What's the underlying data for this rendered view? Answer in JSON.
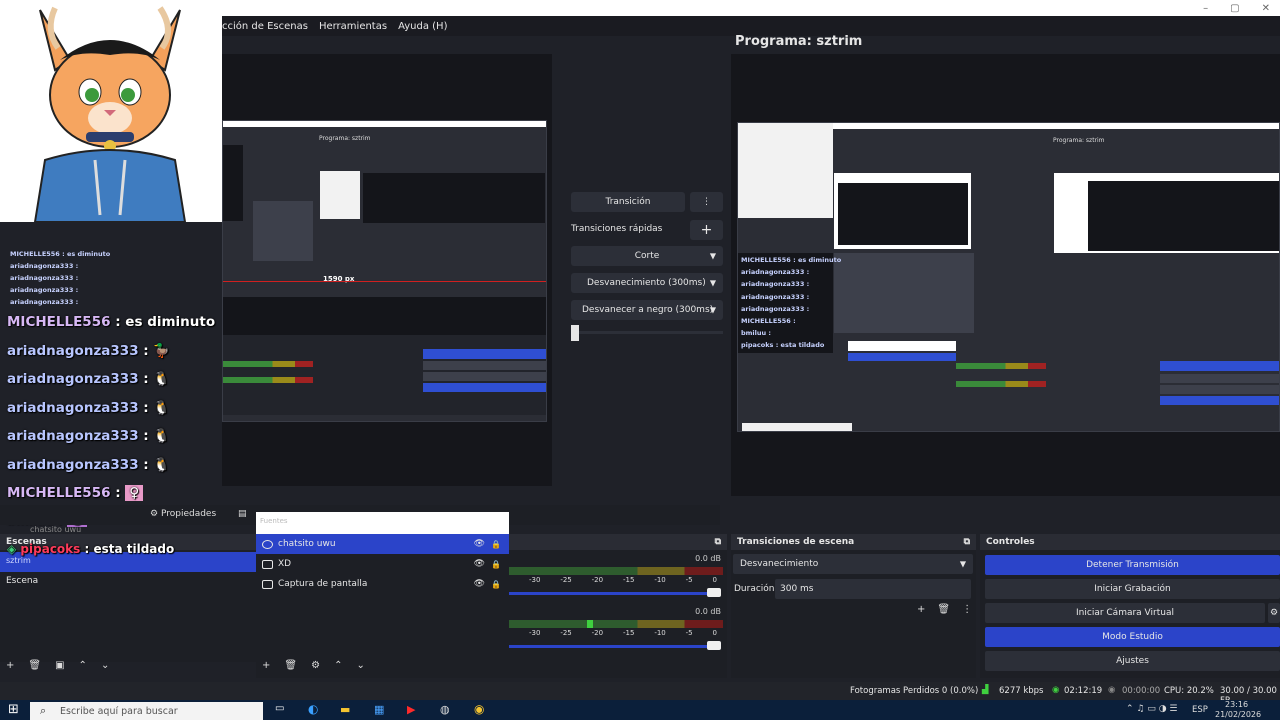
{
  "window": {
    "controls": [
      "–",
      "▢",
      "✕"
    ]
  },
  "menu": {
    "items": [
      "cción de Escenas",
      "Herramientas",
      "Ayuda (H)"
    ]
  },
  "program": {
    "title": "Programa: sztrim"
  },
  "nested_preview": {
    "left_title": "Programa: sztrim",
    "right_title": "Programa: sztrim",
    "px_label": "1590 px",
    "nested_chat": [
      "MICHELLE556 : es diminuto",
      "ariadnagonza333 :",
      "ariadnagonza333 :",
      "ariadnagonza333 :",
      "ariadnagonza333 :",
      "MICHELLE556 :"
    ],
    "nested_chat_right": [
      "MICHELLE556 : es diminuto",
      "ariadnagonza333 :",
      "ariadnagonza333 :",
      "ariadnagonza333 :",
      "ariadnagonza333 :",
      "MICHELLE556 :",
      "bmiluu :",
      "pipacoks : esta tildado"
    ]
  },
  "transition_panel": {
    "transition_button": "Transición",
    "quick_transitions_label": "Transiciones rápidas",
    "options": [
      "Corte",
      "Desvanecimiento (300ms)",
      "Desvanecer a negro (300ms)"
    ]
  },
  "chat": [
    {
      "user": "MICHELLE556",
      "text": ": es diminuto",
      "kind": "mich"
    },
    {
      "user": "ariadnagonza333",
      "text": ":",
      "kind": "aria"
    },
    {
      "user": "ariadnagonza333",
      "text": ":",
      "kind": "aria"
    },
    {
      "user": "ariadnagonza333",
      "text": ":",
      "kind": "aria"
    },
    {
      "user": "ariadnagonza333",
      "text": ":",
      "kind": "aria"
    },
    {
      "user": "MICHELLE556",
      "text": ":",
      "kind": "mich"
    },
    {
      "user": "bmiluu",
      "text": ":",
      "kind": "bmil"
    },
    {
      "user": "pipacoks",
      "text": ": esta tildado",
      "kind": "pipa"
    }
  ],
  "dock_tabs": {
    "properties": "Propiedades",
    "chat_label": "chatsito uwu",
    "fuentes_label": "Fuentes"
  },
  "scenes": {
    "header": "Escenas",
    "selected": "sztrim",
    "items": [
      "Escena"
    ]
  },
  "sources": {
    "items": [
      {
        "name": "chatsito uwu",
        "selected": true
      },
      {
        "name": "XD",
        "selected": false
      },
      {
        "name": "Captura de pantalla",
        "selected": false
      }
    ]
  },
  "audio": {
    "db1": "0.0 dB",
    "db2": "0.0 dB",
    "scale": [
      "-30",
      "-25",
      "-20",
      "-15",
      "-10",
      "-5",
      "0"
    ]
  },
  "scene_transitions": {
    "header": "Transiciones de escena",
    "selected": "Desvanecimiento",
    "duration_label": "Duración",
    "duration_value": "300 ms"
  },
  "controls": {
    "header": "Controles",
    "buttons": [
      "Detener Transmisión",
      "Iniciar Grabación",
      "Iniciar Cámara Virtual",
      "Modo Estudio",
      "Ajustes"
    ]
  },
  "status": {
    "dropped": "Fotogramas Perdidos 0 (0.0%)",
    "bitrate": "6277 kbps",
    "live_time": "02:12:19",
    "rec_time": "00:00:00",
    "cpu": "CPU: 20.2%",
    "fps": "30.00 / 30.00 FP"
  },
  "taskbar": {
    "search_placeholder": "Escribe aquí para buscar",
    "lang": "ESP",
    "time": "23:16",
    "date": "21/02/2026"
  },
  "colors": {
    "accent": "#2b44c9",
    "bg": "#1f2128",
    "panel": "#2a2c34"
  }
}
